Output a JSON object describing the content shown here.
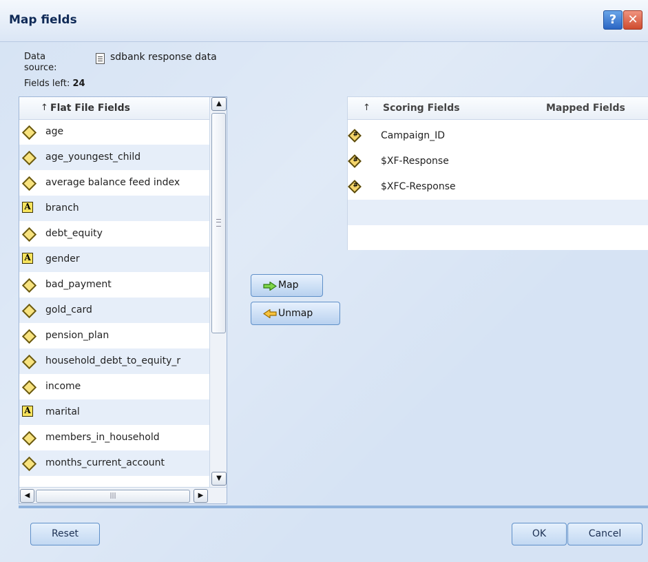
{
  "title": "Map fields",
  "header_buttons": {
    "help": "?",
    "close": "✕"
  },
  "data_source": {
    "label_line1": "Data",
    "label_line2": "source:",
    "value": "sdbank response data"
  },
  "fields_left": {
    "label": "Fields left:",
    "count": "24"
  },
  "left_list": {
    "header_sort": "↑",
    "header": "Flat File Fields",
    "rows": [
      {
        "name": "age",
        "type": "continuous"
      },
      {
        "name": "age_youngest_child",
        "type": "continuous"
      },
      {
        "name": "average balance feed index",
        "type": "continuous"
      },
      {
        "name": "branch",
        "type": "string"
      },
      {
        "name": "debt_equity",
        "type": "continuous"
      },
      {
        "name": "gender",
        "type": "string"
      },
      {
        "name": "bad_payment",
        "type": "continuous"
      },
      {
        "name": "gold_card",
        "type": "continuous"
      },
      {
        "name": "pension_plan",
        "type": "continuous"
      },
      {
        "name": "household_debt_to_equity_r",
        "type": "continuous"
      },
      {
        "name": "income",
        "type": "continuous"
      },
      {
        "name": "marital",
        "type": "string"
      },
      {
        "name": "members_in_household",
        "type": "continuous"
      },
      {
        "name": "months_current_account",
        "type": "continuous"
      }
    ]
  },
  "map_button": "Map",
  "unmap_button": "Unmap",
  "right_list": {
    "header_sort": "↑",
    "header_scoring": "Scoring Fields",
    "header_mapped": "Mapped Fields",
    "rows": [
      {
        "name": "Campaign_ID"
      },
      {
        "name": "$XF-Response"
      },
      {
        "name": "$XFC-Response"
      }
    ]
  },
  "footer": {
    "reset": "Reset",
    "ok": "OK",
    "cancel": "Cancel"
  },
  "colors": {
    "accent": "#0f2a57",
    "dialog_bg": "#d6e3f4",
    "row_alt": "#e6eef9"
  }
}
